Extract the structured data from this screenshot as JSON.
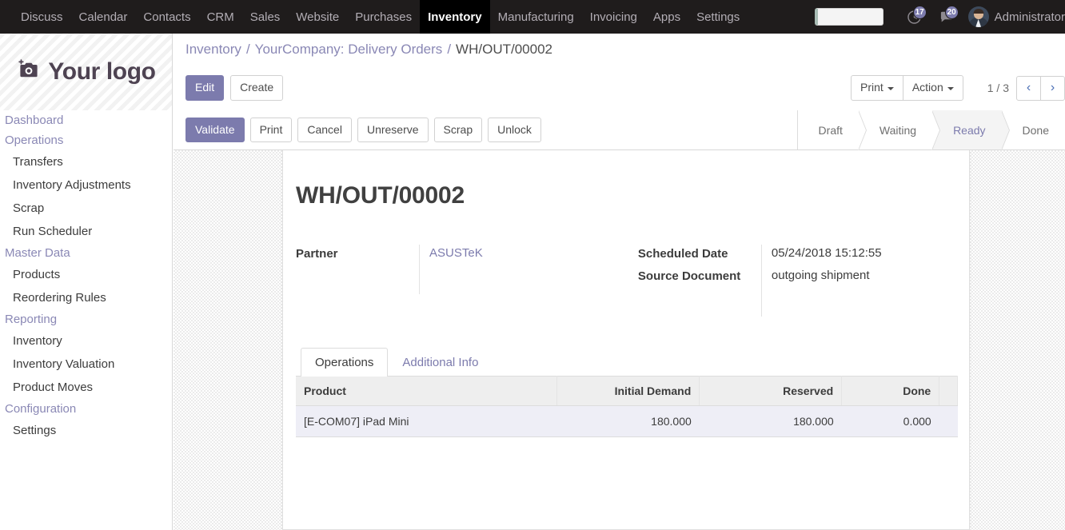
{
  "topbar": {
    "menu": [
      {
        "label": "Discuss",
        "active": false
      },
      {
        "label": "Calendar",
        "active": false
      },
      {
        "label": "Contacts",
        "active": false
      },
      {
        "label": "CRM",
        "active": false
      },
      {
        "label": "Sales",
        "active": false
      },
      {
        "label": "Website",
        "active": false
      },
      {
        "label": "Purchases",
        "active": false
      },
      {
        "label": "Inventory",
        "active": true
      },
      {
        "label": "Manufacturing",
        "active": false
      },
      {
        "label": "Invoicing",
        "active": false
      },
      {
        "label": "Apps",
        "active": false
      },
      {
        "label": "Settings",
        "active": false
      }
    ],
    "search_value": "",
    "search_placeholder": "",
    "activity_icon": "clock-icon",
    "activity_count": "17",
    "messages_icon": "speech-bubble-icon",
    "messages_count": "20",
    "avatar_icon": "avatar",
    "user_name": "Administrator"
  },
  "sidebar": {
    "logo_icon": "camera-icon",
    "logo_text": "Your logo",
    "entries": [
      {
        "label": "Dashboard",
        "type": "section"
      },
      {
        "label": "Operations",
        "type": "section"
      },
      {
        "label": "Transfers",
        "type": "link"
      },
      {
        "label": "Inventory Adjustments",
        "type": "link"
      },
      {
        "label": "Scrap",
        "type": "link"
      },
      {
        "label": "Run Scheduler",
        "type": "link"
      },
      {
        "label": "Master Data",
        "type": "section"
      },
      {
        "label": "Products",
        "type": "link"
      },
      {
        "label": "Reordering Rules",
        "type": "link"
      },
      {
        "label": "Reporting",
        "type": "section"
      },
      {
        "label": "Inventory",
        "type": "link"
      },
      {
        "label": "Inventory Valuation",
        "type": "link"
      },
      {
        "label": "Product Moves",
        "type": "link"
      },
      {
        "label": "Configuration",
        "type": "section"
      },
      {
        "label": "Settings",
        "type": "link"
      }
    ]
  },
  "breadcrumb": {
    "root": "Inventory",
    "parent": "YourCompany: Delivery Orders",
    "current": "WH/OUT/00002",
    "separator": "/"
  },
  "control_panel": {
    "edit_label": "Edit",
    "create_label": "Create",
    "print_label": "Print",
    "action_label": "Action",
    "pager_value": "1 / 3",
    "prev_icon": "chevron-left-icon",
    "next_icon": "chevron-right-icon",
    "prev_glyph": "‹",
    "next_glyph": "›"
  },
  "statusbar": {
    "actions": [
      {
        "label": "Validate",
        "primary": true
      },
      {
        "label": "Print",
        "primary": false
      },
      {
        "label": "Cancel",
        "primary": false
      },
      {
        "label": "Unreserve",
        "primary": false
      },
      {
        "label": "Scrap",
        "primary": false
      },
      {
        "label": "Unlock",
        "primary": false
      }
    ],
    "states": [
      {
        "label": "Draft",
        "active": false
      },
      {
        "label": "Waiting",
        "active": false
      },
      {
        "label": "Ready",
        "active": true
      },
      {
        "label": "Done",
        "active": false
      }
    ]
  },
  "form": {
    "title": "WH/OUT/00002",
    "partner_label": "Partner",
    "partner_value": "ASUSTeK",
    "scheduled_date_label": "Scheduled Date",
    "scheduled_date_value": "05/24/2018 15:12:55",
    "source_document_label": "Source Document",
    "source_document_value": "outgoing shipment"
  },
  "notebook": {
    "tabs": [
      {
        "label": "Operations",
        "active": true
      },
      {
        "label": "Additional Info",
        "active": false
      }
    ]
  },
  "lines_table": {
    "columns": [
      "Product",
      "Initial Demand",
      "Reserved",
      "Done"
    ],
    "rows": [
      {
        "product": "[E-COM07] iPad Mini",
        "initial_demand": "180.000",
        "reserved": "180.000",
        "done": "0.000"
      }
    ]
  },
  "colors": {
    "brand_purple": "#7c7bad",
    "navbar_dark": "#1f1c1c",
    "link_purple": "#8a88b5",
    "row_highlight": "#eeeef6",
    "header_gray": "#eeeeee"
  }
}
